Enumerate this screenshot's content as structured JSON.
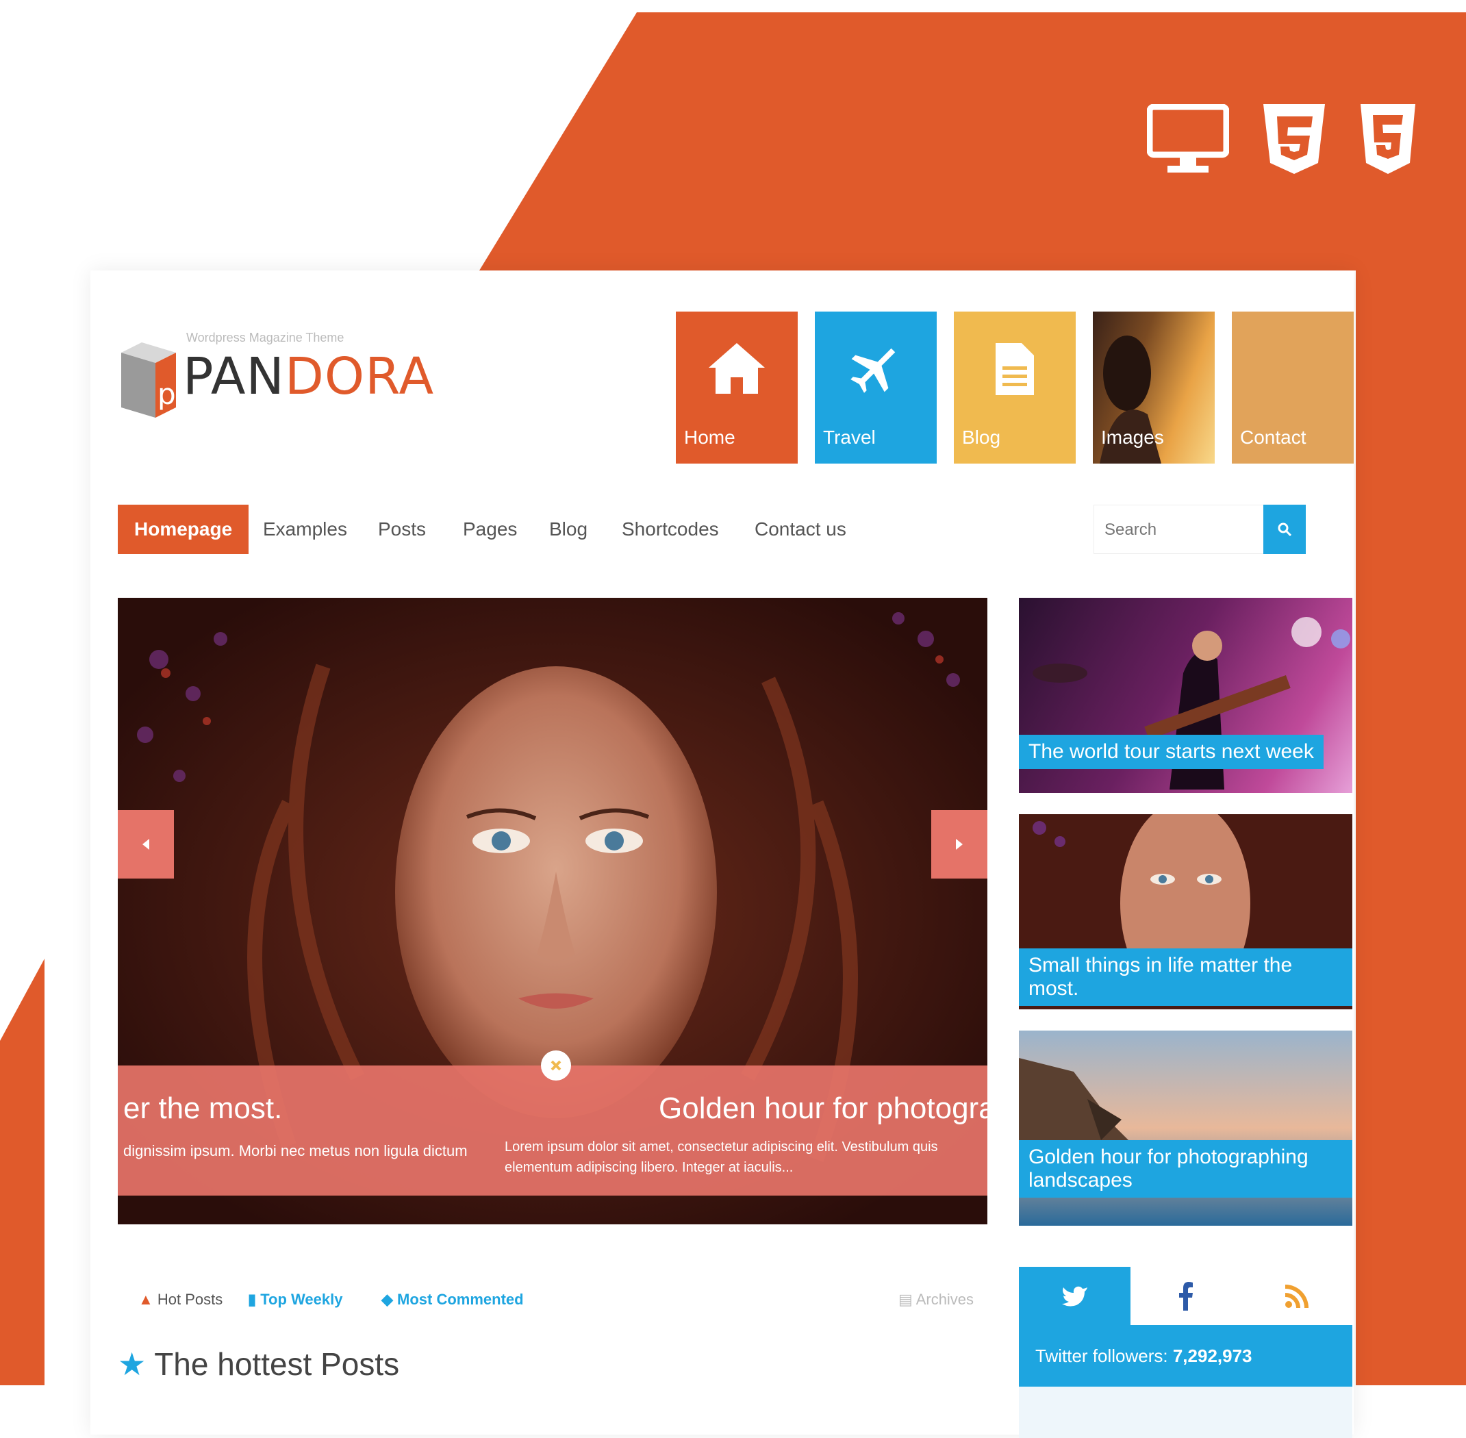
{
  "colors": {
    "orange": "#e05a2b",
    "blue": "#1ea5e0",
    "yellow": "#f0ba4f",
    "tan": "#e1a35a",
    "salmon": "#e57368"
  },
  "top_icons": [
    "desktop-icon",
    "css3-icon",
    "html5-icon"
  ],
  "logo": {
    "text_a": "PAN",
    "text_b": "DORA",
    "tagline": "Wordpress Magazine Theme",
    "badge": "p"
  },
  "tiles": [
    {
      "label": "Home",
      "icon": "home-icon"
    },
    {
      "label": "Travel",
      "icon": "plane-icon"
    },
    {
      "label": "Blog",
      "icon": "document-icon"
    },
    {
      "label": "Images",
      "icon": "image-icon"
    },
    {
      "label": "Contact",
      "icon": ""
    }
  ],
  "nav": {
    "items": [
      "Homepage",
      "Examples",
      "Posts",
      "Pages",
      "Blog",
      "Shortcodes",
      "Contact us"
    ],
    "active": "Homepage"
  },
  "search": {
    "placeholder": "Search"
  },
  "slider": {
    "caption_left_title": "er the most.",
    "caption_left_text": "dignissim ipsum. Morbi nec metus non ligula dictum",
    "caption_right_title": "Golden hour for photograp",
    "caption_right_text": "Lorem ipsum dolor sit amet, consectetur adipiscing elit. Vestibulum quis",
    "caption_right_text2": "elementum adipiscing libero. Integer at iaculis..."
  },
  "side_posts": [
    {
      "caption": "The world tour starts next week"
    },
    {
      "caption": "Small things in life matter the most."
    },
    {
      "caption": "Golden hour for photographing",
      "caption2": "landscapes"
    }
  ],
  "post_tabs": {
    "hot": "Hot Posts",
    "top": "Top Weekly",
    "commented": "Most Commented",
    "archives": "Archives"
  },
  "section_heading": "The hottest Posts",
  "social": {
    "followers_label": "Twitter followers:",
    "followers_count": "7,292,973"
  }
}
